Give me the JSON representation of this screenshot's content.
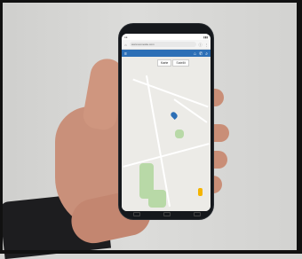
{
  "browser": {
    "url": "www.somesite.com"
  },
  "map": {
    "tabs": [
      {
        "label": "Karte"
      },
      {
        "label": "Satellit"
      }
    ],
    "marker_label": "",
    "accent": "#2c6fb6",
    "park_color": "#b8d9a7"
  },
  "icons": {
    "menu": "menu-icon",
    "home": "home-icon",
    "phone": "phone-icon",
    "search": "search-icon",
    "pegman": "pegman-icon"
  }
}
